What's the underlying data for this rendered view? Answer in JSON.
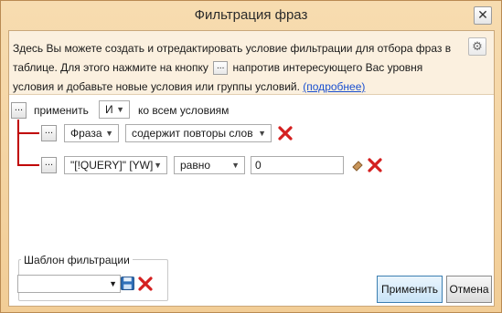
{
  "window": {
    "title": "Фильтрация фраз",
    "close_label": "✕"
  },
  "info": {
    "text_part1": "Здесь Вы можете создать и отредактировать условие фильтрации для отбора фраз в таблице. Для этого нажмите на кнопку",
    "dots": "...",
    "text_part2": "напротив интересующего Вас уровня условия и добавьте новые условия или группы условий.",
    "more_link": "(подробнее)"
  },
  "root_rule": {
    "dots": "...",
    "apply_label": "применить",
    "operator": "И",
    "suffix_label": "ко всем условиям"
  },
  "conditions": [
    {
      "dots": "...",
      "field": "Фраза",
      "operator": "содержит повторы слов",
      "value": ""
    },
    {
      "dots": "...",
      "field": "\"[!QUERY]\" [YW]",
      "operator": "равно",
      "value": "0"
    }
  ],
  "template": {
    "legend": "Шаблон фильтрации",
    "value": ""
  },
  "buttons": {
    "apply": "Применить",
    "cancel": "Отмена"
  },
  "colors": {
    "delete_red": "#d42020",
    "tree_line": "#c00000",
    "save_blue": "#2f6fb8"
  },
  "icons": [
    "close-icon",
    "gear-icon",
    "delete-icon",
    "eraser-icon",
    "save-icon",
    "chevron-down-icon"
  ]
}
